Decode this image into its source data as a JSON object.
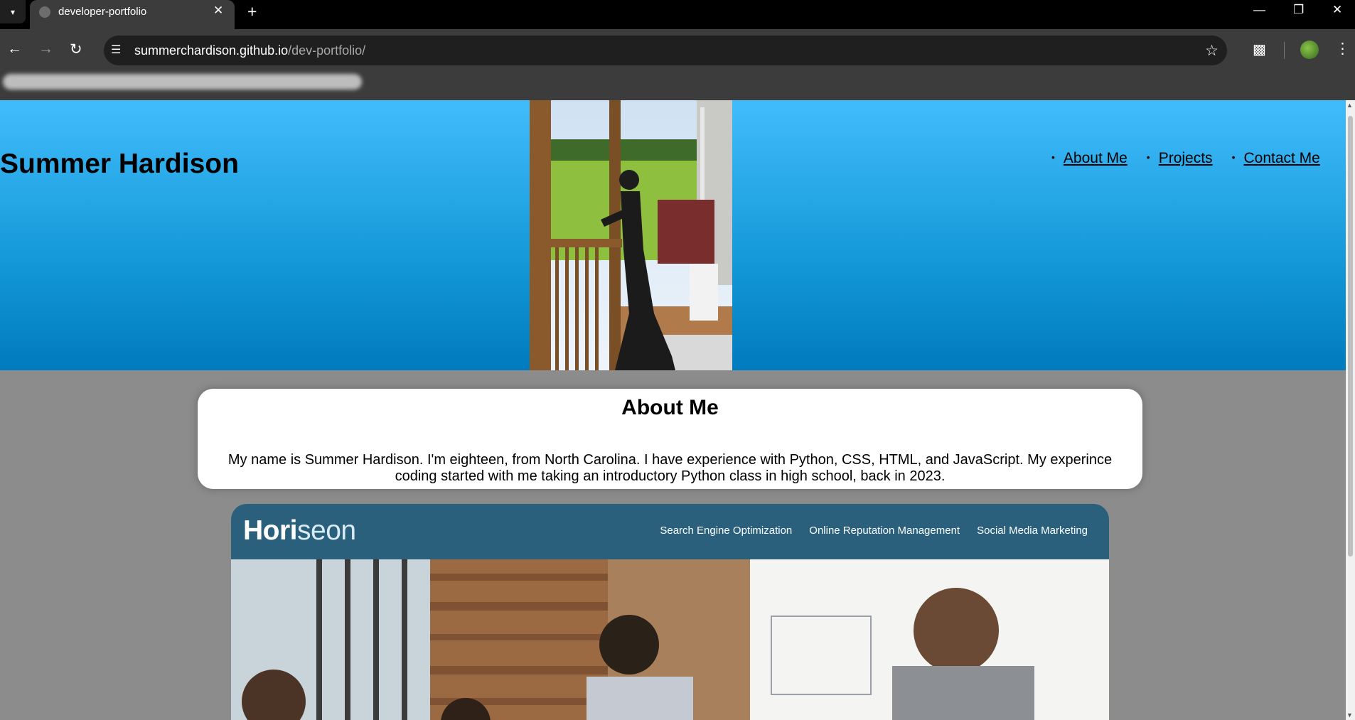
{
  "browser": {
    "tab_title": "developer-portfolio",
    "url_domain": "summerchardison.github.io",
    "url_path": "/dev-portfolio/"
  },
  "icons": {
    "tab_search": "chevron-down-icon",
    "tab_close": "close-icon",
    "new_tab": "plus-icon",
    "back": "arrow-left-icon",
    "forward": "arrow-right-icon",
    "reload": "reload-icon",
    "site_info": "tune-icon",
    "bookmark": "star-icon",
    "extensions": "puzzle-icon",
    "menu": "kebab-menu-icon"
  },
  "header": {
    "name": "Summer Hardison",
    "nav": [
      "About Me",
      "Projects",
      "Contact Me"
    ]
  },
  "about": {
    "title": "About Me",
    "text": "My name is Summer Hardison. I'm eighteen, from North Carolina. I have experience with Python, CSS, HTML, and JavaScript. My experince coding started with me taking an introductory Python class in high school, back in 2023."
  },
  "project": {
    "logo_main": "Hori",
    "logo_accent": "seon",
    "nav": [
      "Search Engine Optimization",
      "Online Reputation Management",
      "Social Media Marketing"
    ]
  },
  "colors": {
    "hero_top": "#41bcfb",
    "hero_bottom": "#007bbd",
    "page_background": "#8c8c8c",
    "project_header": "#2a607c"
  }
}
